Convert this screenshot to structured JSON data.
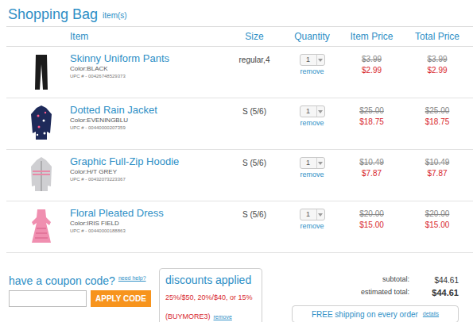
{
  "title": "Shopping Bag",
  "subtitle": "item(s)",
  "columns": [
    "Item",
    "Size",
    "Quantity",
    "Item Price",
    "Total Price"
  ],
  "items": [
    {
      "kind": "pants",
      "name": "Skinny Uniform Pants",
      "color_label": "Color:BLACK",
      "upc": "UPC # - 00426748529373",
      "size": "regular,4",
      "quantity": "1",
      "remove": "remove",
      "was_price": "$3.99",
      "price": "$2.99",
      "was_total": "$3.99",
      "total": "$2.99"
    },
    {
      "kind": "jacket",
      "name": "Dotted Rain Jacket",
      "color_label": "Color:EVENINGBLU",
      "upc": "UPC # - 00440000207359",
      "size": "S (5/6)",
      "quantity": "1",
      "remove": "remove",
      "was_price": "$25.00",
      "price": "$18.75",
      "was_total": "$25.00",
      "total": "$18.75"
    },
    {
      "kind": "hoodie",
      "name": "Graphic Full-Zip Hoodie",
      "color_label": "Color:H/T GREY",
      "upc": "UPC # - 00432073223367",
      "size": "S (5/6)",
      "quantity": "1",
      "remove": "remove",
      "was_price": "$10.49",
      "price": "$7.87",
      "was_total": "$10.49",
      "total": "$7.87"
    },
    {
      "kind": "dress",
      "name": "Floral Pleated Dress",
      "color_label": "Color:IRIS FIELD",
      "upc": "UPC # - 00440000188863",
      "size": "S (5/6)",
      "quantity": "1",
      "remove": "remove",
      "was_price": "$20.00",
      "price": "$15.00",
      "was_total": "$20.00",
      "total": "$15.00"
    }
  ],
  "coupon": {
    "label": "have a coupon code?",
    "help": "need help?",
    "button": "APPLY CODE"
  },
  "discounts": {
    "title": "discounts applied",
    "text": "25%/$50, 20%/$40, or 15% (BUYMORE3)",
    "remove": "remove"
  },
  "summary": [
    {
      "label": "subtotal:",
      "value": "$44.61",
      "bold": false
    },
    {
      "label": "estimated total:",
      "value": "$44.61",
      "bold": true
    }
  ],
  "shipping": {
    "text": "FREE shipping on every order",
    "link": "details"
  }
}
